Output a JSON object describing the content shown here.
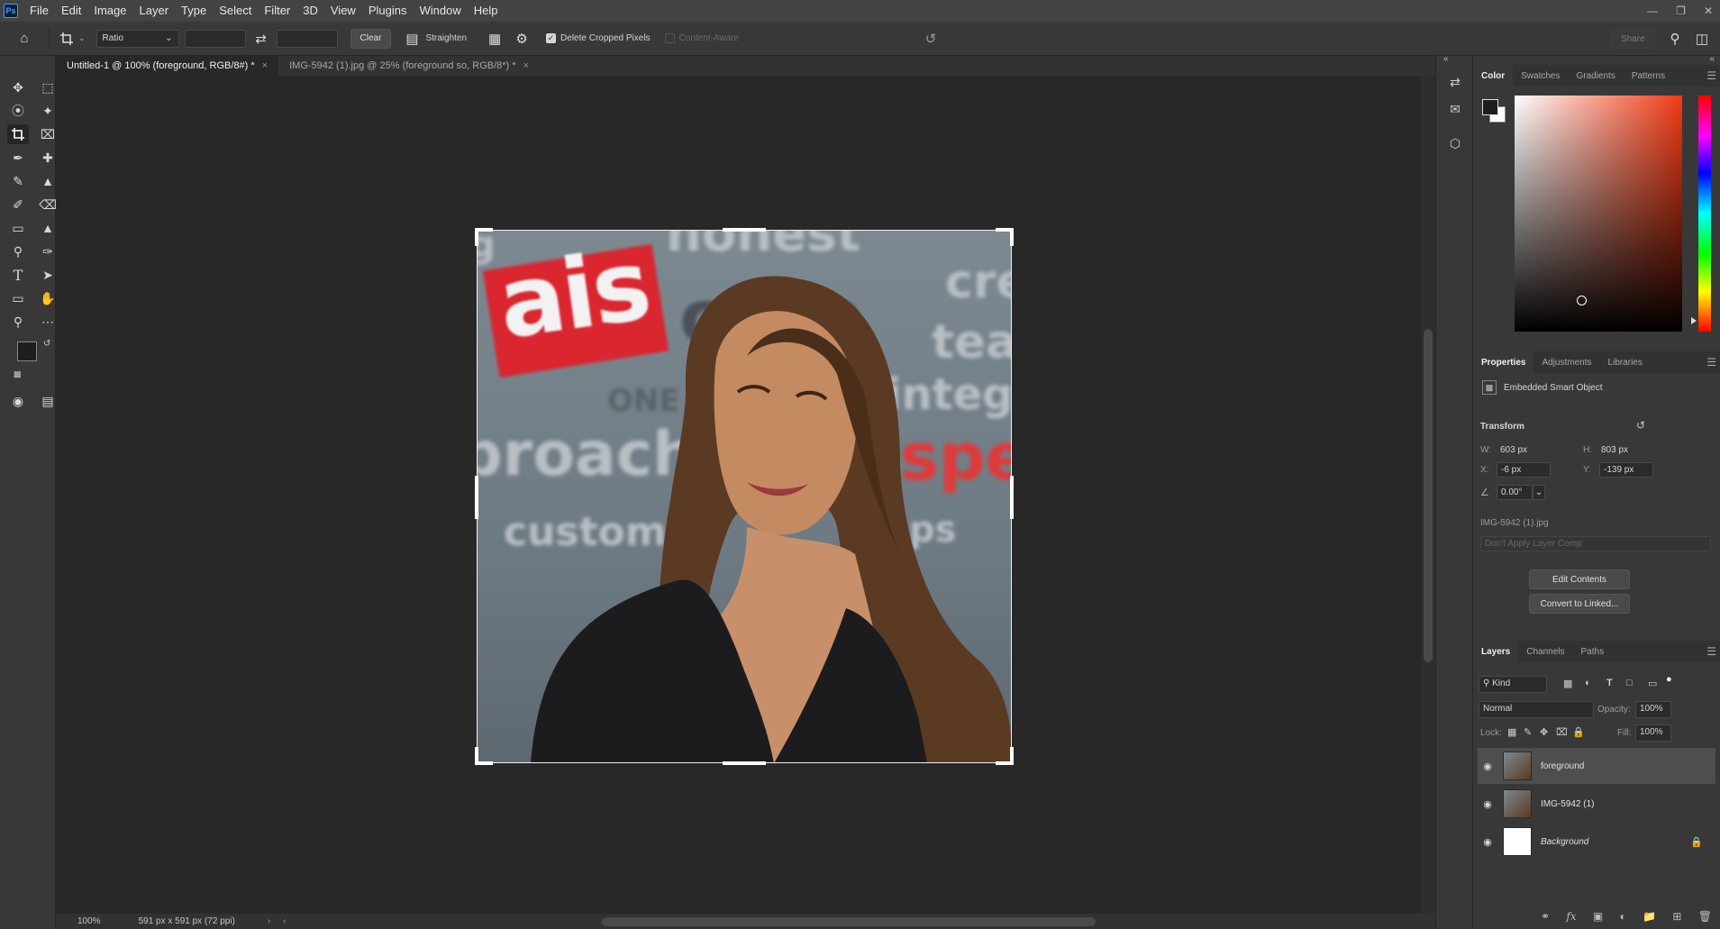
{
  "app": {
    "logo": "Ps"
  },
  "menu": [
    "File",
    "Edit",
    "Image",
    "Layer",
    "Type",
    "Select",
    "Filter",
    "3D",
    "View",
    "Plugins",
    "Window",
    "Help"
  ],
  "window_controls": [
    "minimize-icon",
    "restore-icon",
    "close-icon"
  ],
  "options": {
    "ratio_label": "Ratio",
    "clear_label": "Clear",
    "straighten_label": "Straighten",
    "delete_cropped_label": "Delete Cropped Pixels",
    "delete_cropped_checked": true,
    "content_aware_label": "Content-Aware",
    "content_aware_checked": false,
    "share_label": "Share"
  },
  "tabs": [
    {
      "label": "Untitled-1 @ 100% (foreground, RGB/8#) *",
      "active": true
    },
    {
      "label": "IMG-5942 (1).jpg @ 25% (foreground so, RGB/8*) *",
      "active": false
    }
  ],
  "image_text": {
    "brand": "ais",
    "words": [
      "honest",
      "corp",
      "cre",
      "tea",
      "integr",
      "ONE",
      "proach",
      "spe",
      "custom",
      "ps",
      "g"
    ]
  },
  "status": {
    "zoom": "100%",
    "doc_size": "591 px x 591 px (72 ppi)"
  },
  "color_panel": {
    "tabs": [
      "Color",
      "Swatches",
      "Gradients",
      "Patterns"
    ],
    "foreground": "#1e1e1e",
    "background": "#ffffff"
  },
  "properties": {
    "tabs": [
      "Properties",
      "Adjustments",
      "Libraries"
    ],
    "object_type": "Embedded Smart Object",
    "section": "Transform",
    "w_label": "W:",
    "w": "603 px",
    "h_label": "H:",
    "h": "803 px",
    "x_label": "X:",
    "x": "-6 px",
    "y_label": "Y:",
    "y": "-139 px",
    "angle": "0.00°",
    "file": "IMG-5942 (1).jpg",
    "layer_comp": "Don't Apply Layer Comp",
    "edit_contents": "Edit Contents",
    "convert_linked": "Convert to Linked..."
  },
  "layers_panel": {
    "tabs": [
      "Layers",
      "Channels",
      "Paths"
    ],
    "filter": "Kind",
    "blend_mode": "Normal",
    "opacity_label": "Opacity:",
    "opacity": "100%",
    "lock_label": "Lock:",
    "fill_label": "Fill:",
    "fill": "100%",
    "layers": [
      {
        "name": "foreground",
        "selected": true
      },
      {
        "name": "IMG-5942 (1)",
        "selected": false
      },
      {
        "name": "Background",
        "selected": false
      }
    ]
  }
}
